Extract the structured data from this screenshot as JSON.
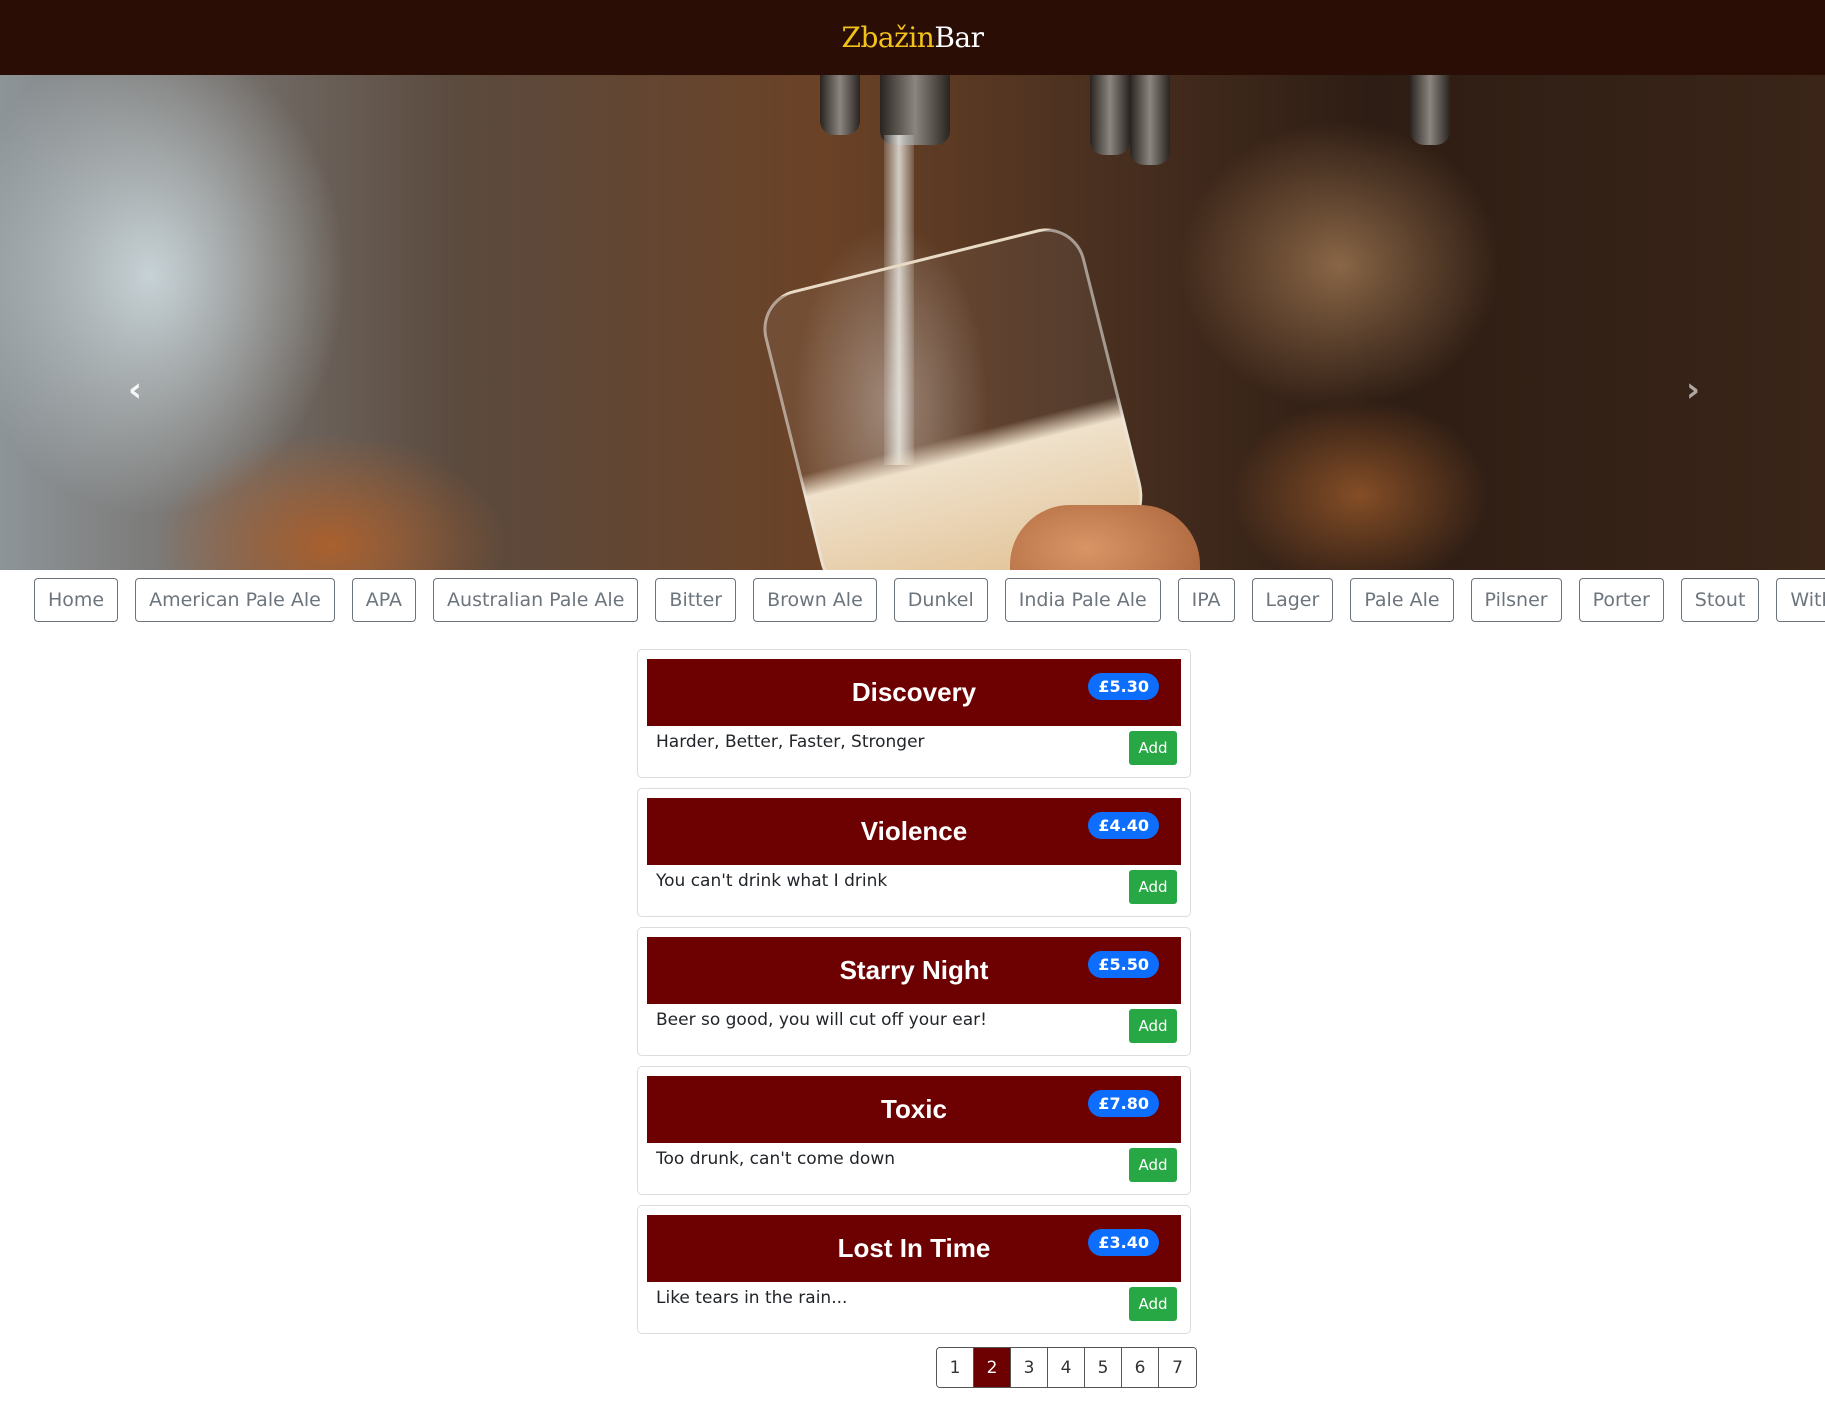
{
  "brand": {
    "accent_text": "Zbažin",
    "rest_text": "Bar",
    "accent_color": "#f2c21a",
    "nav_bg": "#2a0e06"
  },
  "carousel": {
    "prev_icon": "chevron-left-icon",
    "next_icon": "chevron-right-icon",
    "prev_glyph": "‹",
    "next_glyph": "›",
    "slide_count": 4,
    "active_slide": 3
  },
  "categories": [
    "Home",
    "American Pale Ale",
    "APA",
    "Australian Pale Ale",
    "Bitter",
    "Brown Ale",
    "Dunkel",
    "India Pale Ale",
    "IPA",
    "Lager",
    "Pale Ale",
    "Pilsner",
    "Porter",
    "Stout",
    "Witbier"
  ],
  "beers": [
    {
      "name": "Discovery",
      "price": "£5.30",
      "description": "Harder, Better, Faster, Stronger",
      "add_label": "Add"
    },
    {
      "name": "Violence",
      "price": "£4.40",
      "description": "You can't drink what I drink",
      "add_label": "Add"
    },
    {
      "name": "Starry Night",
      "price": "£5.50",
      "description": "Beer so good, you will cut off your ear!",
      "add_label": "Add"
    },
    {
      "name": "Toxic",
      "price": "£7.80",
      "description": "Too drunk, can't come down",
      "add_label": "Add"
    },
    {
      "name": "Lost In Time",
      "price": "£3.40",
      "description": "Like tears in the rain...",
      "add_label": "Add"
    }
  ],
  "pagination": {
    "pages": [
      "1",
      "2",
      "3",
      "4",
      "5",
      "6",
      "7"
    ],
    "active": "2"
  },
  "colors": {
    "card_header": "#6d0000",
    "price_badge": "#0d6efd",
    "add_button": "#28a745"
  }
}
